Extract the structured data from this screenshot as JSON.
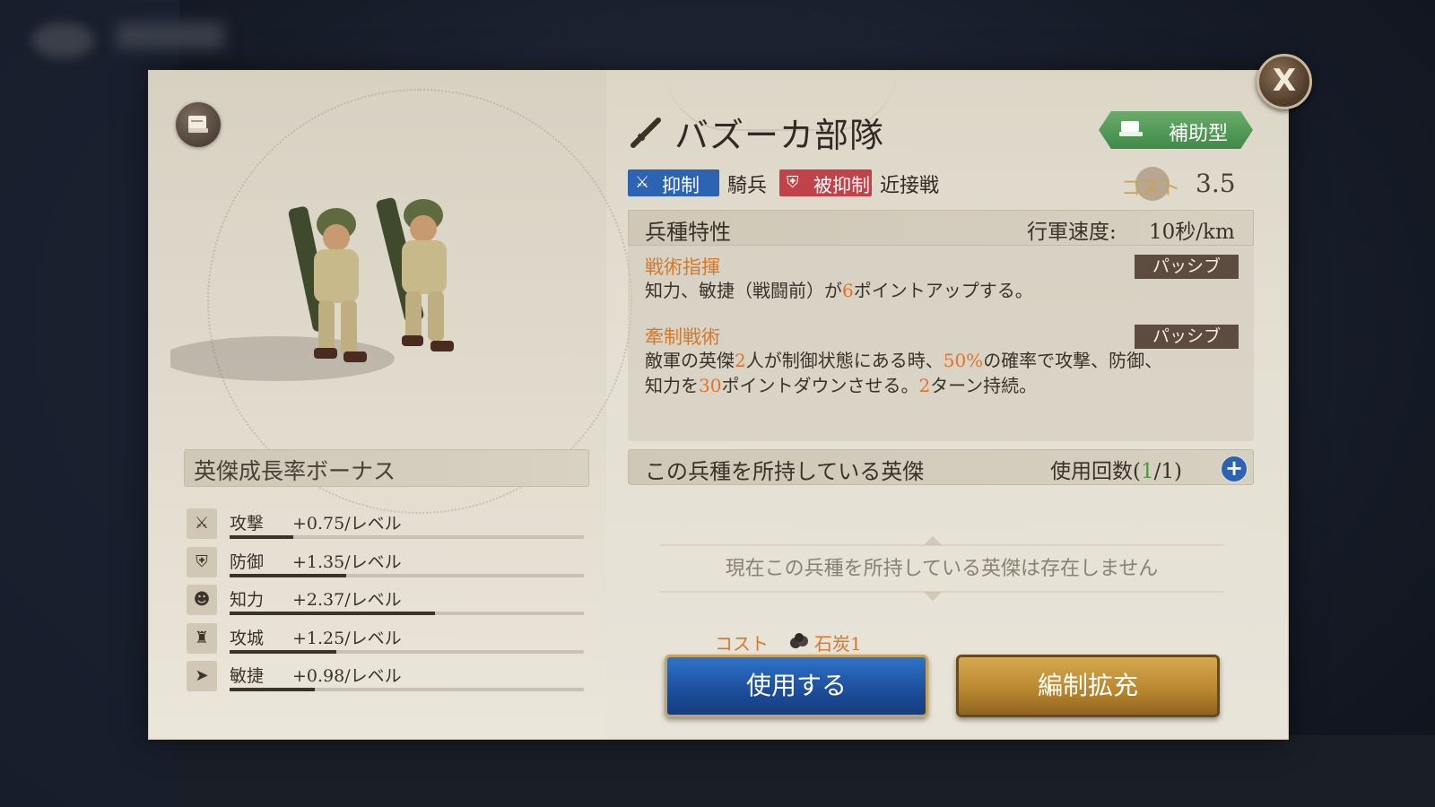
{
  "close_label": "X",
  "unit": {
    "name": "バズーカ部隊",
    "type_badge": "補助型",
    "counters_label": "抑制",
    "counters_target": "騎兵",
    "countered_label": "被抑制",
    "countered_target": "近接戦",
    "cost_label": "コスト",
    "cost_value": "3.5"
  },
  "features": {
    "title": "兵種特性",
    "speed_label": "行軍速度:",
    "speed_value": "10秒/km",
    "skills": [
      {
        "name": "戦術指揮",
        "tag": "パッシブ",
        "desc_parts": [
          "知力、敏捷（戦闘前）が",
          "6",
          "ポイントアップする。"
        ]
      },
      {
        "name": "牽制戦術",
        "tag": "パッシブ",
        "desc_parts": [
          "敵軍の英傑",
          "2",
          "人が制御状態にある時、",
          "50%",
          "の確率で攻撃、防御、",
          "知力を",
          "30",
          "ポイントダウンさせる。",
          "2",
          "ターン持続。"
        ]
      }
    ]
  },
  "growth": {
    "title": "英傑成長率ボーナス",
    "stats": [
      {
        "name": "攻撃",
        "value": "+0.75/レベル",
        "icon": "sword-icon",
        "fill": 0.18
      },
      {
        "name": "防御",
        "value": "+1.35/レベル",
        "icon": "shield-icon",
        "fill": 0.33
      },
      {
        "name": "知力",
        "value": "+2.37/レベル",
        "icon": "head-icon",
        "fill": 0.58
      },
      {
        "name": "攻城",
        "value": "+1.25/レベル",
        "icon": "castle-icon",
        "fill": 0.3
      },
      {
        "name": "敏捷",
        "value": "+0.98/レベル",
        "icon": "boot-icon",
        "fill": 0.24
      }
    ]
  },
  "owners": {
    "title": "この兵種を所持している英傑",
    "usage_prefix": "使用回数(",
    "usage_current": "1",
    "usage_suffix": "/1)",
    "empty_message": "現在この兵種を所持している英傑は存在しません"
  },
  "action": {
    "cost_label": "コスト",
    "cost_item": "石炭1",
    "use_button": "使用する",
    "expand_button": "編制拡充"
  },
  "colors": {
    "counter_blue": "#2d63b3",
    "countered_red": "#c0434a",
    "highlight_orange": "#e0742a",
    "badge_green": "#4f9a52"
  }
}
